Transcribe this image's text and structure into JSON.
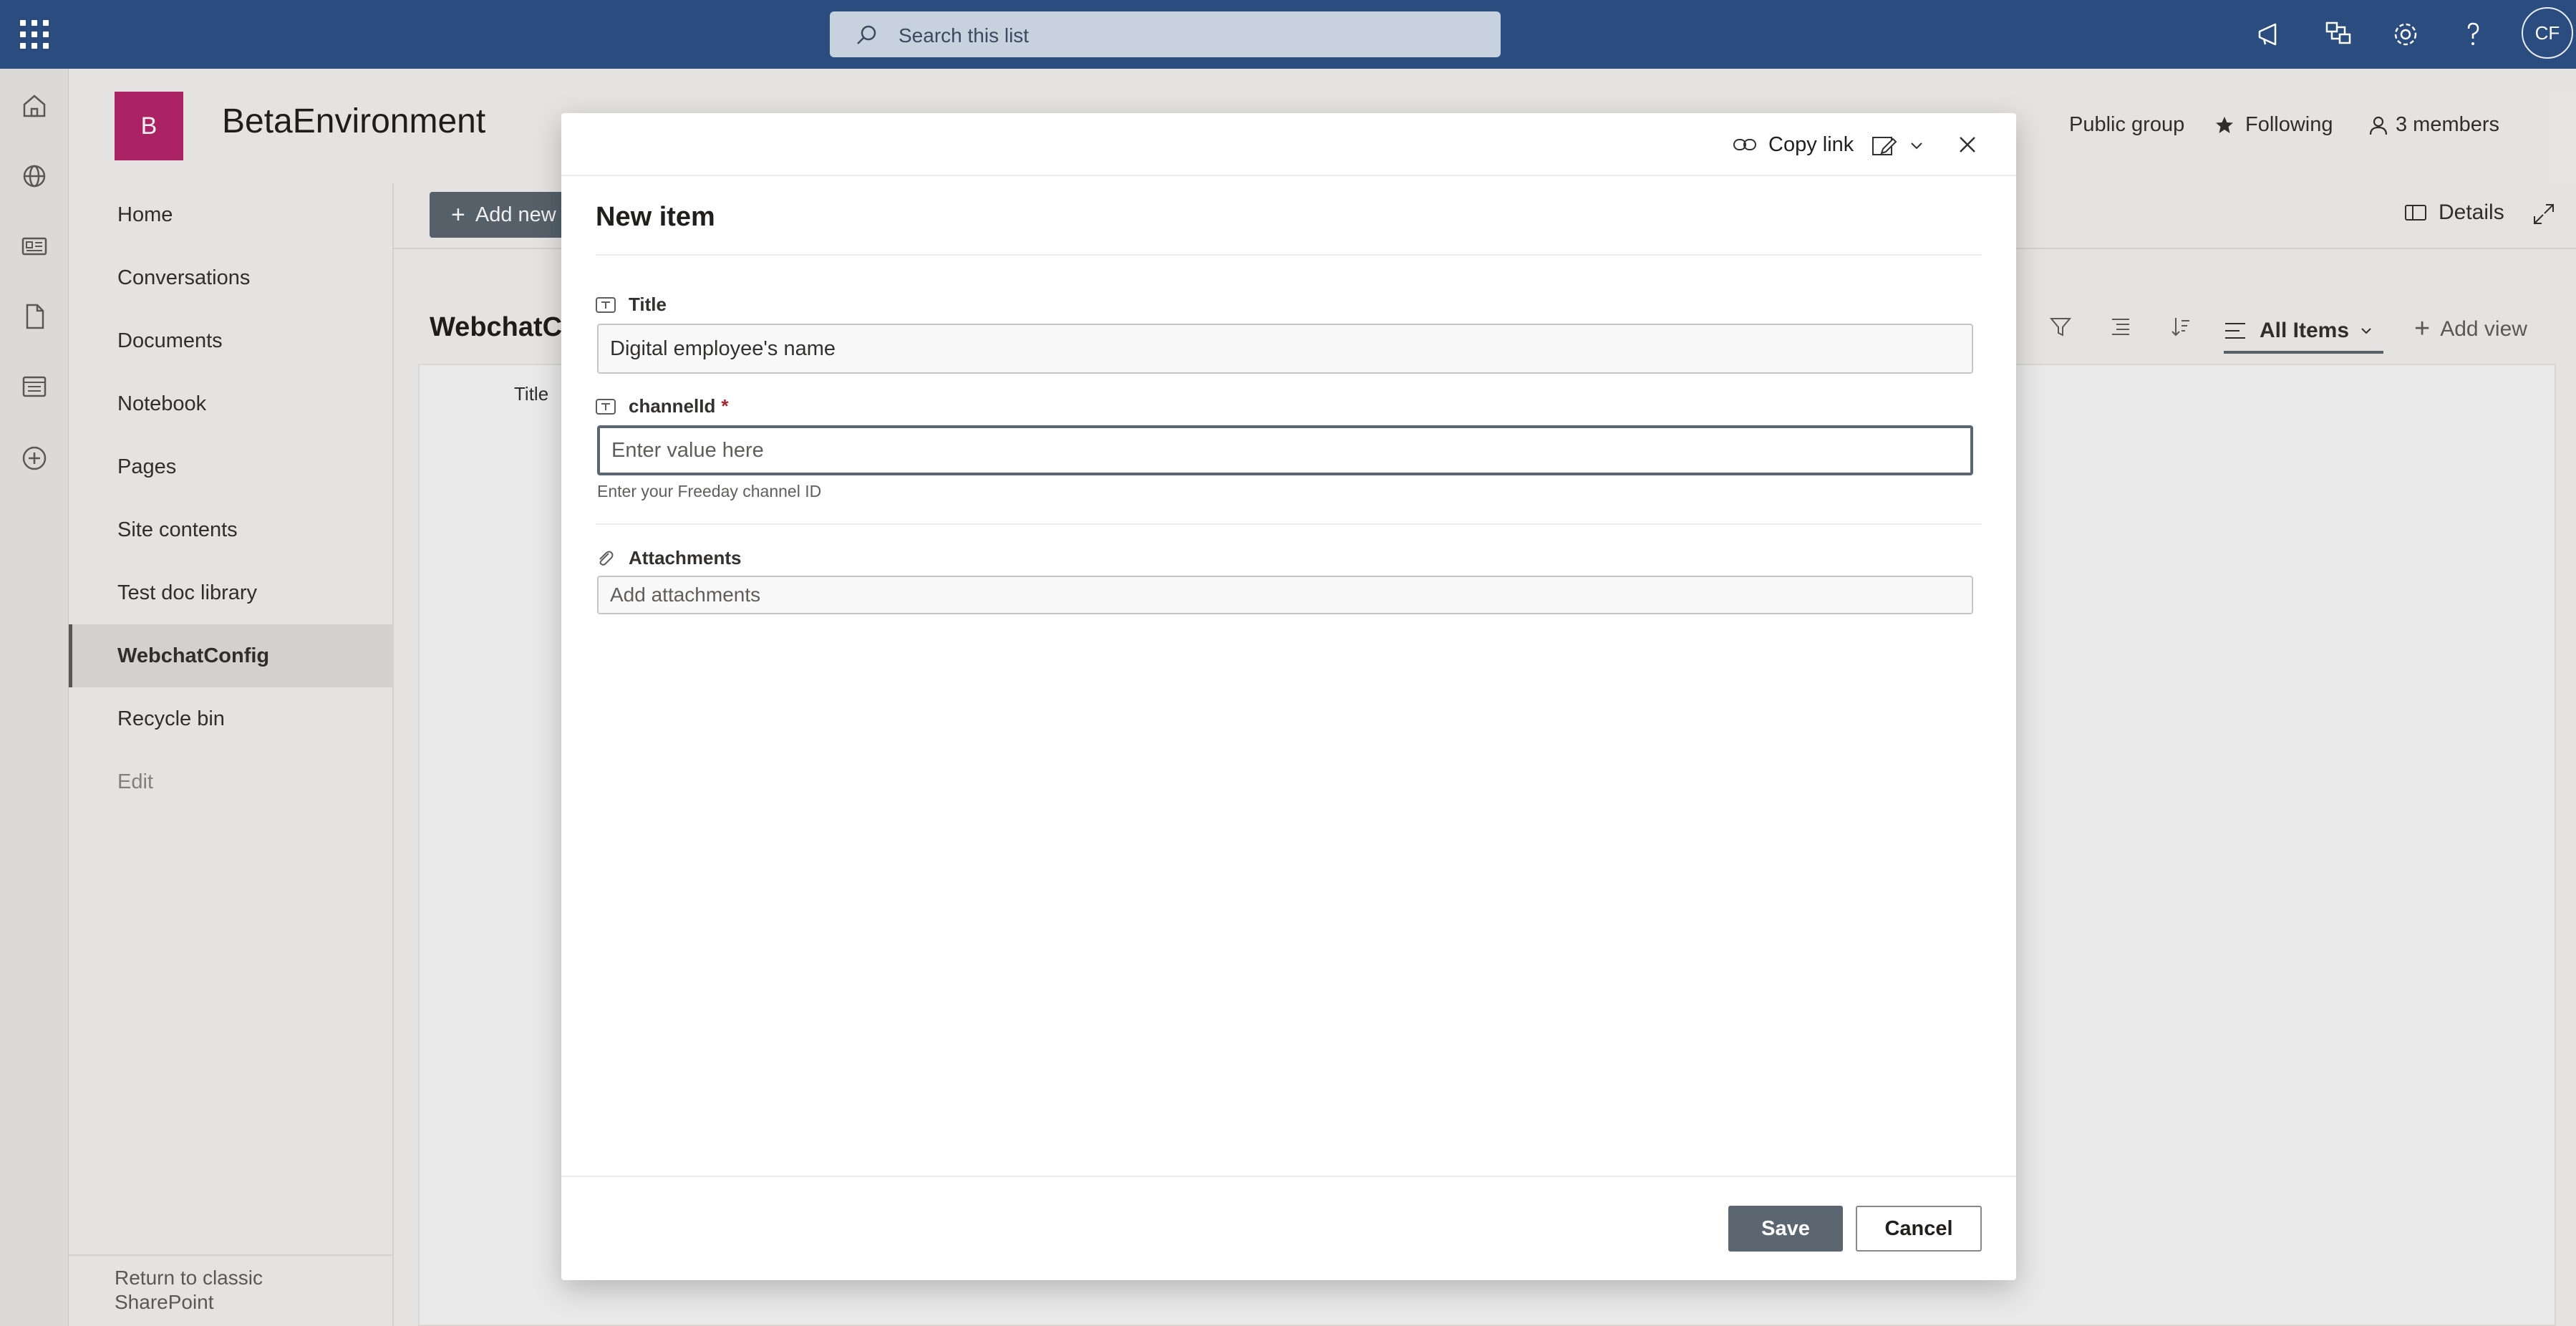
{
  "suite_bar": {
    "search_placeholder": "Search this list",
    "user_initials": "CF",
    "icons": [
      "app-launcher-icon",
      "megaphone-icon",
      "share-icon",
      "settings-icon",
      "help-icon"
    ]
  },
  "app_rail": {
    "icons": [
      "home-icon",
      "globe-icon",
      "news-icon",
      "file-icon",
      "list-icon",
      "add-icon"
    ]
  },
  "site": {
    "logo_letter": "B",
    "title": "BetaEnvironment",
    "privacy": "Public group",
    "following": "Following",
    "members": "3 members"
  },
  "nav": {
    "items": [
      {
        "label": "Home"
      },
      {
        "label": "Conversations"
      },
      {
        "label": "Documents"
      },
      {
        "label": "Notebook"
      },
      {
        "label": "Pages"
      },
      {
        "label": "Site contents"
      },
      {
        "label": "Test doc library"
      },
      {
        "label": "WebchatConfig",
        "active": true
      },
      {
        "label": "Recycle bin"
      },
      {
        "label": "Edit",
        "muted": true
      }
    ],
    "return_link": "Return to classic SharePoint"
  },
  "list": {
    "add_new_label": "Add new",
    "title": "WebchatConfig",
    "column_title": "Title",
    "details_label": "Details",
    "view_name": "All Items",
    "add_view_label": "Add view"
  },
  "dialog": {
    "copy_link_label": "Copy link",
    "title": "New item",
    "fields": {
      "title": {
        "label": "Title",
        "value": "Digital employee's name"
      },
      "channel_id": {
        "label": "channelId",
        "required_mark": "*",
        "placeholder": "Enter value here",
        "help": "Enter your Freeday channel ID"
      },
      "attachments": {
        "label": "Attachments",
        "placeholder": "Add attachments"
      }
    },
    "save_label": "Save",
    "cancel_label": "Cancel"
  },
  "colors": {
    "suite_bar": "#2b4c7e",
    "site_logo": "#b5256b",
    "primary_button": "#5b6670",
    "required": "#a4262c"
  }
}
